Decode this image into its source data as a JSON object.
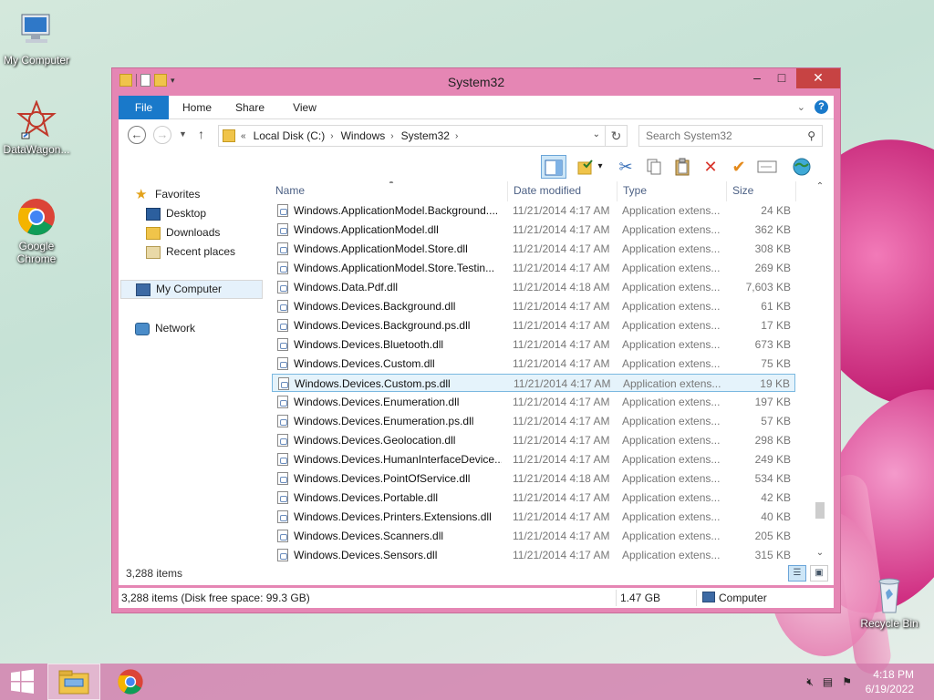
{
  "desktop": {
    "icons": [
      {
        "label": "My Computer"
      },
      {
        "label": "DataWagon..."
      },
      {
        "label": "Google Chrome"
      },
      {
        "label": "Recycle Bin"
      }
    ]
  },
  "window": {
    "title": "System32",
    "ribbon_tabs": [
      "File",
      "Home",
      "Share",
      "View"
    ],
    "address": {
      "overflow": "«",
      "crumbs": [
        "Local Disk (C:)",
        "Windows",
        "System32"
      ]
    },
    "search_placeholder": "Search System32",
    "nav": {
      "favorites": "Favorites",
      "desktop": "Desktop",
      "downloads": "Downloads",
      "recent": "Recent places",
      "computer": "My Computer",
      "network": "Network"
    },
    "columns": {
      "name": "Name",
      "date": "Date modified",
      "type": "Type",
      "size": "Size"
    },
    "files": [
      {
        "name": "Windows.ApplicationModel.Background....",
        "date": "11/21/2014 4:17 AM",
        "type": "Application extens...",
        "size": "24 KB"
      },
      {
        "name": "Windows.ApplicationModel.dll",
        "date": "11/21/2014 4:17 AM",
        "type": "Application extens...",
        "size": "362 KB"
      },
      {
        "name": "Windows.ApplicationModel.Store.dll",
        "date": "11/21/2014 4:17 AM",
        "type": "Application extens...",
        "size": "308 KB"
      },
      {
        "name": "Windows.ApplicationModel.Store.Testin...",
        "date": "11/21/2014 4:17 AM",
        "type": "Application extens...",
        "size": "269 KB"
      },
      {
        "name": "Windows.Data.Pdf.dll",
        "date": "11/21/2014 4:18 AM",
        "type": "Application extens...",
        "size": "7,603 KB"
      },
      {
        "name": "Windows.Devices.Background.dll",
        "date": "11/21/2014 4:17 AM",
        "type": "Application extens...",
        "size": "61 KB"
      },
      {
        "name": "Windows.Devices.Background.ps.dll",
        "date": "11/21/2014 4:17 AM",
        "type": "Application extens...",
        "size": "17 KB"
      },
      {
        "name": "Windows.Devices.Bluetooth.dll",
        "date": "11/21/2014 4:17 AM",
        "type": "Application extens...",
        "size": "673 KB"
      },
      {
        "name": "Windows.Devices.Custom.dll",
        "date": "11/21/2014 4:17 AM",
        "type": "Application extens...",
        "size": "75 KB"
      },
      {
        "name": "Windows.Devices.Custom.ps.dll",
        "date": "11/21/2014 4:17 AM",
        "type": "Application extens...",
        "size": "19 KB",
        "selected": true
      },
      {
        "name": "Windows.Devices.Enumeration.dll",
        "date": "11/21/2014 4:17 AM",
        "type": "Application extens...",
        "size": "197 KB"
      },
      {
        "name": "Windows.Devices.Enumeration.ps.dll",
        "date": "11/21/2014 4:17 AM",
        "type": "Application extens...",
        "size": "57 KB"
      },
      {
        "name": "Windows.Devices.Geolocation.dll",
        "date": "11/21/2014 4:17 AM",
        "type": "Application extens...",
        "size": "298 KB"
      },
      {
        "name": "Windows.Devices.HumanInterfaceDevice....",
        "date": "11/21/2014 4:17 AM",
        "type": "Application extens...",
        "size": "249 KB"
      },
      {
        "name": "Windows.Devices.PointOfService.dll",
        "date": "11/21/2014 4:18 AM",
        "type": "Application extens...",
        "size": "534 KB"
      },
      {
        "name": "Windows.Devices.Portable.dll",
        "date": "11/21/2014 4:17 AM",
        "type": "Application extens...",
        "size": "42 KB"
      },
      {
        "name": "Windows.Devices.Printers.Extensions.dll",
        "date": "11/21/2014 4:17 AM",
        "type": "Application extens...",
        "size": "40 KB"
      },
      {
        "name": "Windows.Devices.Scanners.dll",
        "date": "11/21/2014 4:17 AM",
        "type": "Application extens...",
        "size": "205 KB"
      },
      {
        "name": "Windows.Devices.Sensors.dll",
        "date": "11/21/2014 4:17 AM",
        "type": "Application extens...",
        "size": "315 KB"
      }
    ],
    "item_count": "3,288 items",
    "status": {
      "left": "3,288 items (Disk free space: 99.3 GB)",
      "size": "1.47 GB",
      "location": "Computer"
    }
  },
  "taskbar": {
    "time": "4:18 PM",
    "date": "6/19/2022"
  },
  "colors": {
    "accent": "#1979ca",
    "window_frame": "#e586b4",
    "close": "#c74343",
    "selection": "#e5f3fb"
  }
}
